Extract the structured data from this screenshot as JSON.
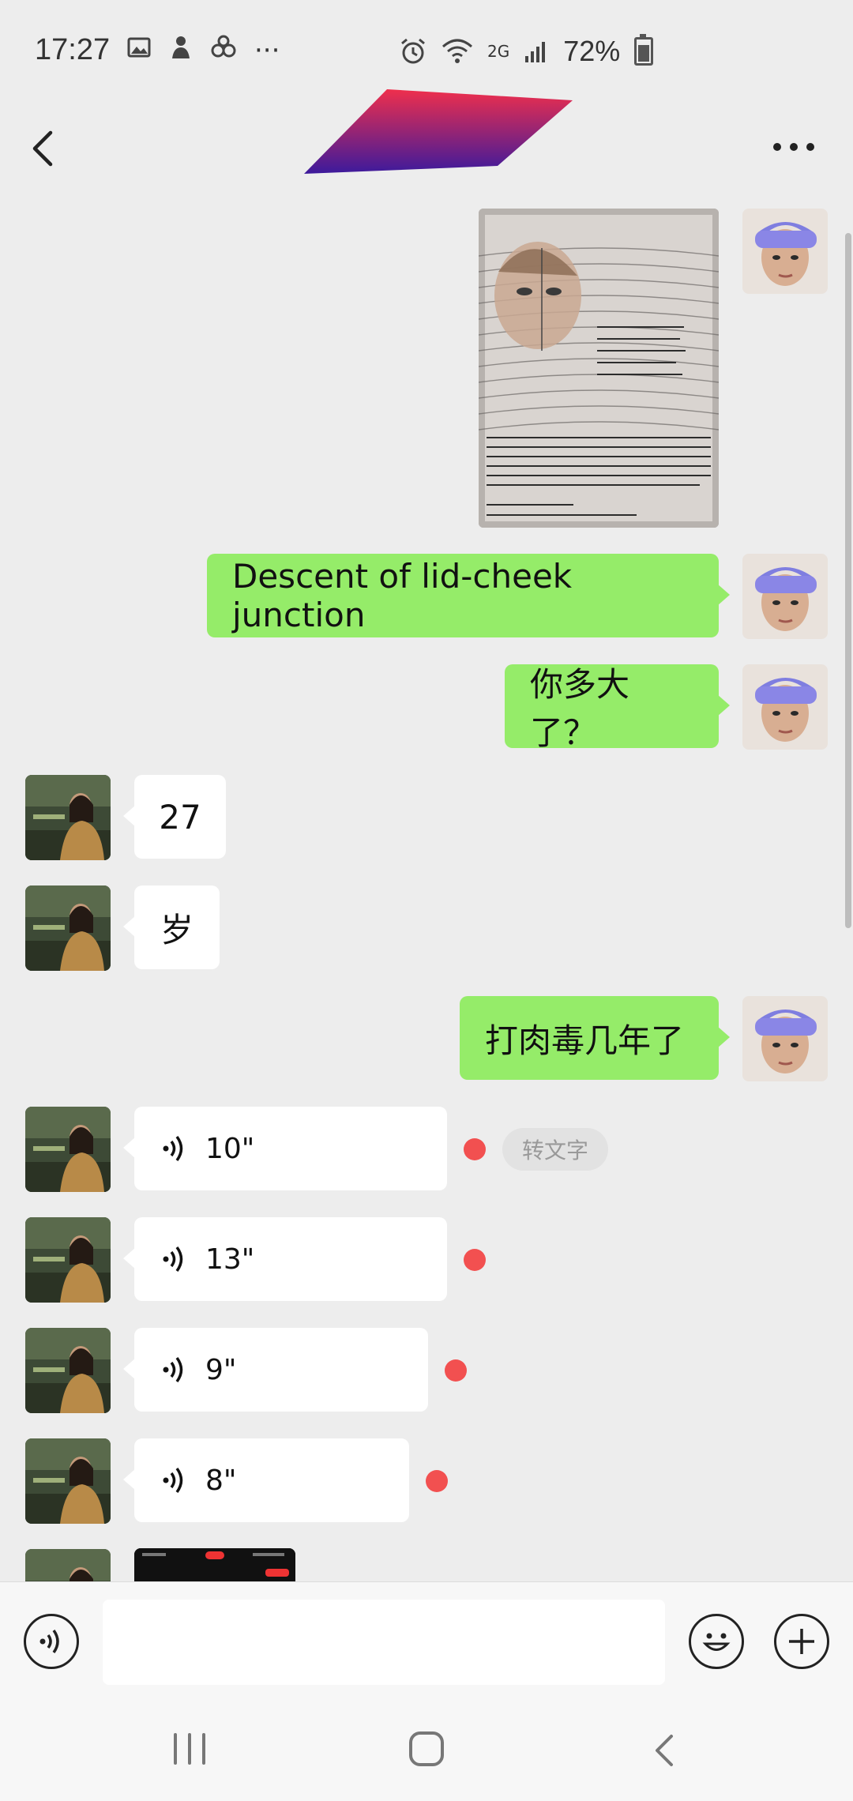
{
  "status_bar": {
    "time": "17:27",
    "network": "2G",
    "battery": "72%",
    "more": "···"
  },
  "header": {
    "back_icon": "chevron-left-icon",
    "more_icon": "more-dots-icon"
  },
  "messages": {
    "m2_text": "Descent of lid-cheek junction",
    "m3_text": "你多大了？",
    "m4_text": "27",
    "m5_text": "岁",
    "m6_text": "打肉毒几年了",
    "voice1": "10\"",
    "voice2": "13\"",
    "voice3": "9\"",
    "voice4": "8\"",
    "transcribe_label": "转文字"
  },
  "colors": {
    "bubble_me": "#95ec69",
    "bubble_other": "#ffffff",
    "unread_dot": "#f25050",
    "background": "#ededed"
  },
  "input_bar": {
    "voice_icon": "voice-toggle-icon",
    "emoji_icon": "emoji-icon",
    "plus_icon": "plus-icon",
    "text_value": ""
  }
}
